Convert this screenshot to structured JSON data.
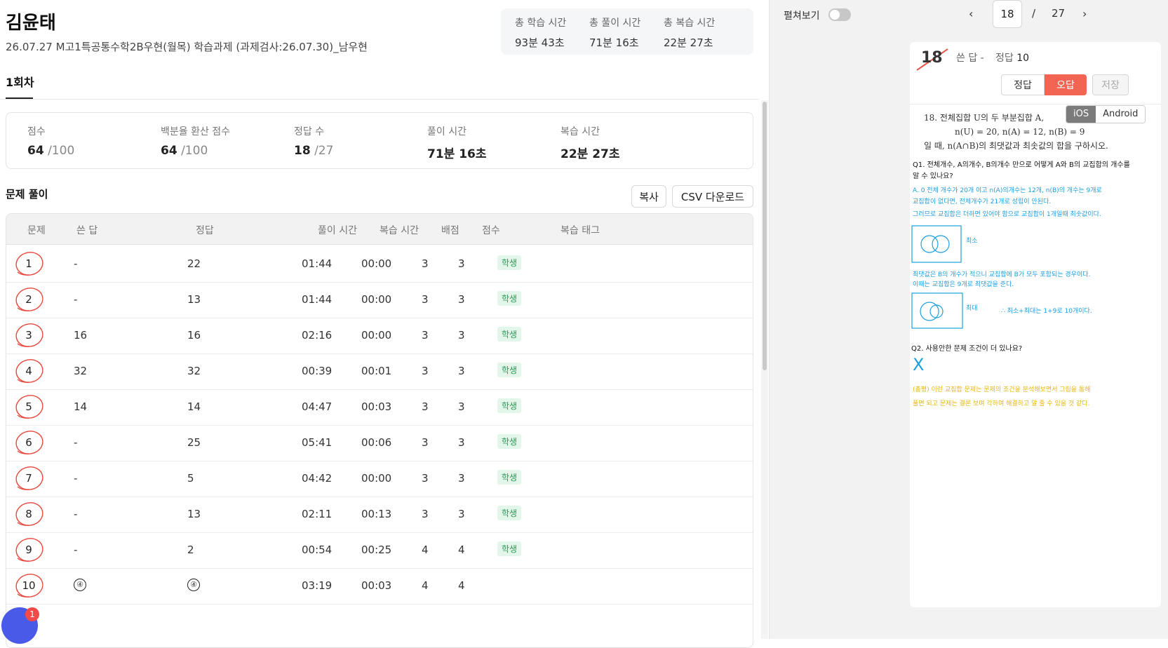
{
  "header": {
    "student_name": "김윤태",
    "assignment_title": "26.07.27 M고1특공통수학2B우현(월목) 학습과제 (과제검사:26.07.30)_남우현"
  },
  "totals": [
    {
      "label": "총 학습 시간",
      "value": "93분 43초"
    },
    {
      "label": "총 풀이 시간",
      "value": "71분 16초"
    },
    {
      "label": "총 복습 시간",
      "value": "22분 27초"
    }
  ],
  "round_tab": "1회차",
  "stats": {
    "score_label": "점수",
    "score": "64",
    "score_total": "/100",
    "percent_label": "백분율 환산 점수",
    "percent": "64",
    "percent_total": "/100",
    "correct_label": "정답 수",
    "correct": "18",
    "correct_total": "/27",
    "solve_label": "풀이 시간",
    "solve": "71분 16초",
    "review_label": "복습 시간",
    "review": "22분 27초"
  },
  "section": {
    "title": "문제 풀이",
    "copy_button": "복사",
    "csv_button": "CSV 다운로드"
  },
  "table": {
    "headers": [
      "문제",
      "쓴 답",
      "정답",
      "풀이 시간",
      "복습 시간",
      "배점",
      "점수",
      "복습 태그"
    ],
    "rows": [
      {
        "q": "1",
        "written": "-",
        "answer": "22",
        "solve": "01:44",
        "review": "00:00",
        "points": "3",
        "score": "3",
        "tag": "학생"
      },
      {
        "q": "2",
        "written": "-",
        "answer": "13",
        "solve": "01:44",
        "review": "00:00",
        "points": "3",
        "score": "3",
        "tag": "학생"
      },
      {
        "q": "3",
        "written": "16",
        "answer": "16",
        "solve": "02:16",
        "review": "00:00",
        "points": "3",
        "score": "3",
        "tag": "학생"
      },
      {
        "q": "4",
        "written": "32",
        "answer": "32",
        "solve": "00:39",
        "review": "00:01",
        "points": "3",
        "score": "3",
        "tag": "학생"
      },
      {
        "q": "5",
        "written": "14",
        "answer": "14",
        "solve": "04:47",
        "review": "00:03",
        "points": "3",
        "score": "3",
        "tag": "학생"
      },
      {
        "q": "6",
        "written": "-",
        "answer": "25",
        "solve": "05:41",
        "review": "00:06",
        "points": "3",
        "score": "3",
        "tag": "학생"
      },
      {
        "q": "7",
        "written": "-",
        "answer": "5",
        "solve": "04:42",
        "review": "00:00",
        "points": "3",
        "score": "3",
        "tag": "학생"
      },
      {
        "q": "8",
        "written": "-",
        "answer": "13",
        "solve": "02:11",
        "review": "00:13",
        "points": "3",
        "score": "3",
        "tag": "학생"
      },
      {
        "q": "9",
        "written": "-",
        "answer": "2",
        "solve": "00:54",
        "review": "00:25",
        "points": "4",
        "score": "4",
        "tag": "학생"
      },
      {
        "q": "10",
        "written": "④",
        "answer": "④",
        "solve": "03:19",
        "review": "00:03",
        "points": "4",
        "score": "4",
        "tag": ""
      }
    ]
  },
  "chat": {
    "badge": "1"
  },
  "viewer": {
    "spread_label": "펼쳐보기",
    "page_current": "18",
    "page_sep": "/",
    "page_total": "27",
    "card": {
      "qnum": "18",
      "written_label": "쓴 답 -",
      "answer_label": "정답",
      "answer_value": "10",
      "correct_btn": "정답",
      "wrong_btn": "오답",
      "save_btn": "저장",
      "os_ios": "iOS",
      "os_android": "Android",
      "problem_line1": "18.  전체집합  U의  두  부분집합  A,",
      "problem_line2": "n(U) = 20,  n(A) = 12,  n(B) = 9",
      "problem_line3": "일  때,  n(A∩B)의  최댓값과  최솟값의  합을 구하시오.",
      "hw_q1": "Q1. 전체개수, A의개수, B의개수 만으로 어떻게 A와 B의 교집합의 개수를",
      "hw_q1b": "알 수 있나요?",
      "hw_a1": "A. 0  전체 개수가 20개 이고  n(A)의개수는 12개, n(B)의 개수는 9개로",
      "hw_a1b": "교집합이 없다면, 전체개수가 21개로 성립이 안된다.",
      "hw_a1c": "그러므로 교집합은 더하면 있어야 함으로 교집합이 1개일때 최솟값이다.",
      "hw_min": "최소",
      "hw_max_note": "최댓값은 B의 개수가 적으니 교집합에 B가 모두 포함되는 경우이다.",
      "hw_max_note2": "이때는 교집합은 9개로 최댓값을 준다.",
      "hw_max": "최대",
      "hw_sum": "∴ 최소+최대는 1+9로 10개이다.",
      "hw_q2": "Q2. 사용안한 문제 조건이 더 있나요?",
      "hw_x": "X",
      "hw_feedback": "(총평) 이런 교집합 문제는 문제의 조건을 분석해보면서 그림을 통해",
      "hw_feedback2": "풀면 되고 문제는 결론 보며 각하며 해결하고 알 줄 수 있을 것 같다."
    }
  }
}
